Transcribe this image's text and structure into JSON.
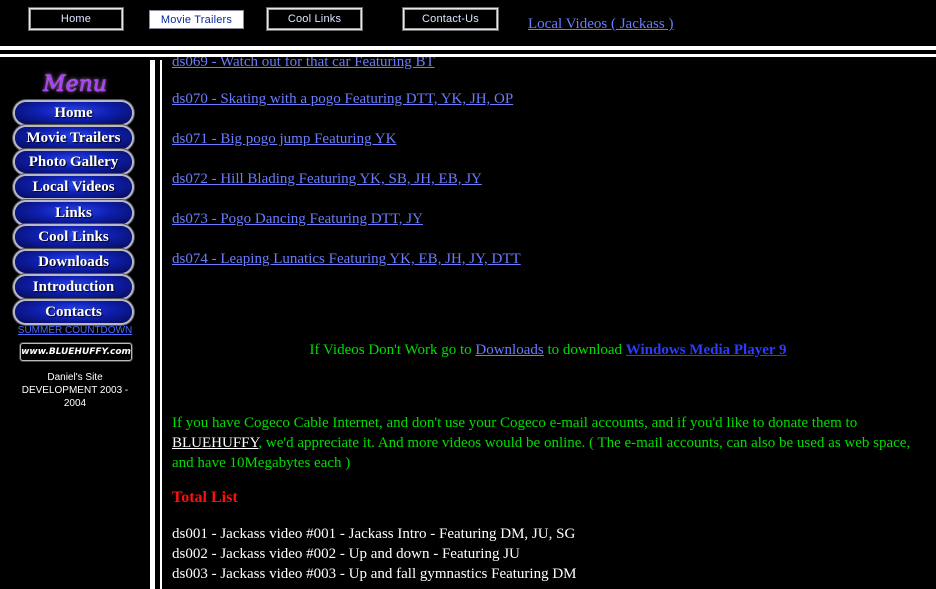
{
  "topnav": {
    "buttons": [
      "Home",
      "Movie Trailers",
      "Cool Links",
      "Contact-Us"
    ],
    "active_index": 1,
    "section_link": "Local Videos ( Jackass )"
  },
  "sidebar": {
    "title": "Menu",
    "items": [
      "Home",
      "Movie Trailers",
      "Photo Gallery",
      "Local Videos",
      "Links",
      "Cool Links",
      "Downloads",
      "Introduction",
      "Contacts"
    ],
    "countdown": "SUMMER COUNTDOWN",
    "logo_text": "www.BLUEHUFFY.com",
    "dev_note": "Daniel's Site DEVELOPMENT 2003 - 2004"
  },
  "videos": [
    "ds069 - Watch out for that car Featuring BT",
    "ds070 - Skating with a pogo Featuring DTT, YK, JH, OP",
    "ds071 - Big pogo jump Featuring YK",
    "ds072 - Hill Blading Featuring YK, SB, JH, EB, JY",
    "ds073 - Pogo Dancing Featuring DTT, JY",
    "ds074 - Leaping Lunatics Featuring YK, EB, JH, JY, DTT"
  ],
  "notice": {
    "prefix": "If Videos Don't Work go to ",
    "downloads": "Downloads",
    "middle": " to download ",
    "player": "Windows Media Player 9"
  },
  "donate": {
    "part1": "If you have Cogeco Cable Internet, and don't use your Cogeco e-mail accounts, and if you'd like to donate them to ",
    "link": "BLUEHUFFY",
    "part2": ", we'd appreciate it. And more videos would be online. ( The e-mail accounts, can also be used as web space, and have 10Megabytes each )"
  },
  "total_list": {
    "heading": "Total List",
    "entries": [
      "ds001 - Jackass video #001 - Jackass Intro - Featuring DM, JU, SG",
      "ds002 - Jackass video #002 - Up and down - Featuring JU",
      "ds003 - Jackass video #003 - Up and fall gymnastics Featuring DM"
    ]
  },
  "colors": {
    "link": "#6a7cff",
    "green_text": "#00dd00",
    "heading_red": "#ff1010",
    "menu_title": "#b03cff"
  }
}
